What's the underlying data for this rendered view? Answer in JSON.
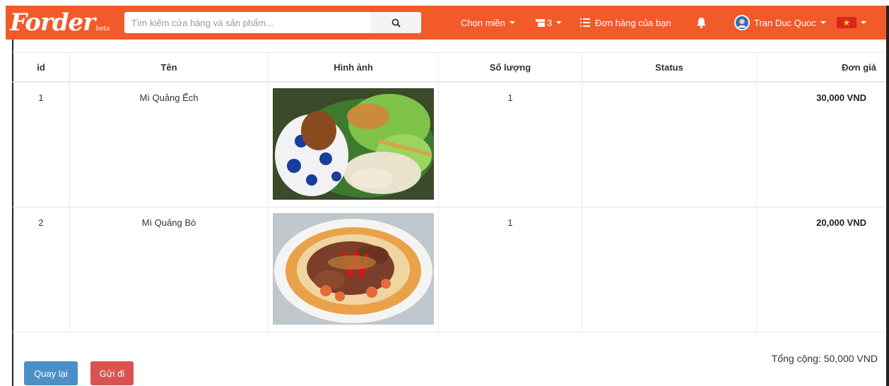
{
  "navbar": {
    "logo_text": "Forder",
    "logo_beta": "beta",
    "search_placeholder": "Tìm kiếm cửa hàng và sản phẩm...",
    "region_label": "Chọn miền",
    "cart_count": "3",
    "orders_label": "Đơn hàng của bạn",
    "user_name": "Tran Duc Quoc"
  },
  "table": {
    "headers": [
      "id",
      "Tên",
      "Hình ảnh",
      "Số lượng",
      "Status",
      "Đơn giá"
    ],
    "rows": [
      {
        "id": "1",
        "name": "Mì Quảng Ếch",
        "image": "mi-quang-ech-photo",
        "qty": "1",
        "status": "",
        "price": "30,000 VND"
      },
      {
        "id": "2",
        "name": "Mì Quảng Bò",
        "image": "mi-quang-bo-photo",
        "qty": "1",
        "status": "",
        "price": "20,000 VND"
      }
    ]
  },
  "total_label": "Tổng cộng: 50,000 VND",
  "buttons": {
    "back": "Quay lại",
    "send": "Gửi đi"
  },
  "colors": {
    "navbar": "#f25a2a",
    "back_button": "#4a8fc8",
    "send_button": "#d9534f"
  }
}
